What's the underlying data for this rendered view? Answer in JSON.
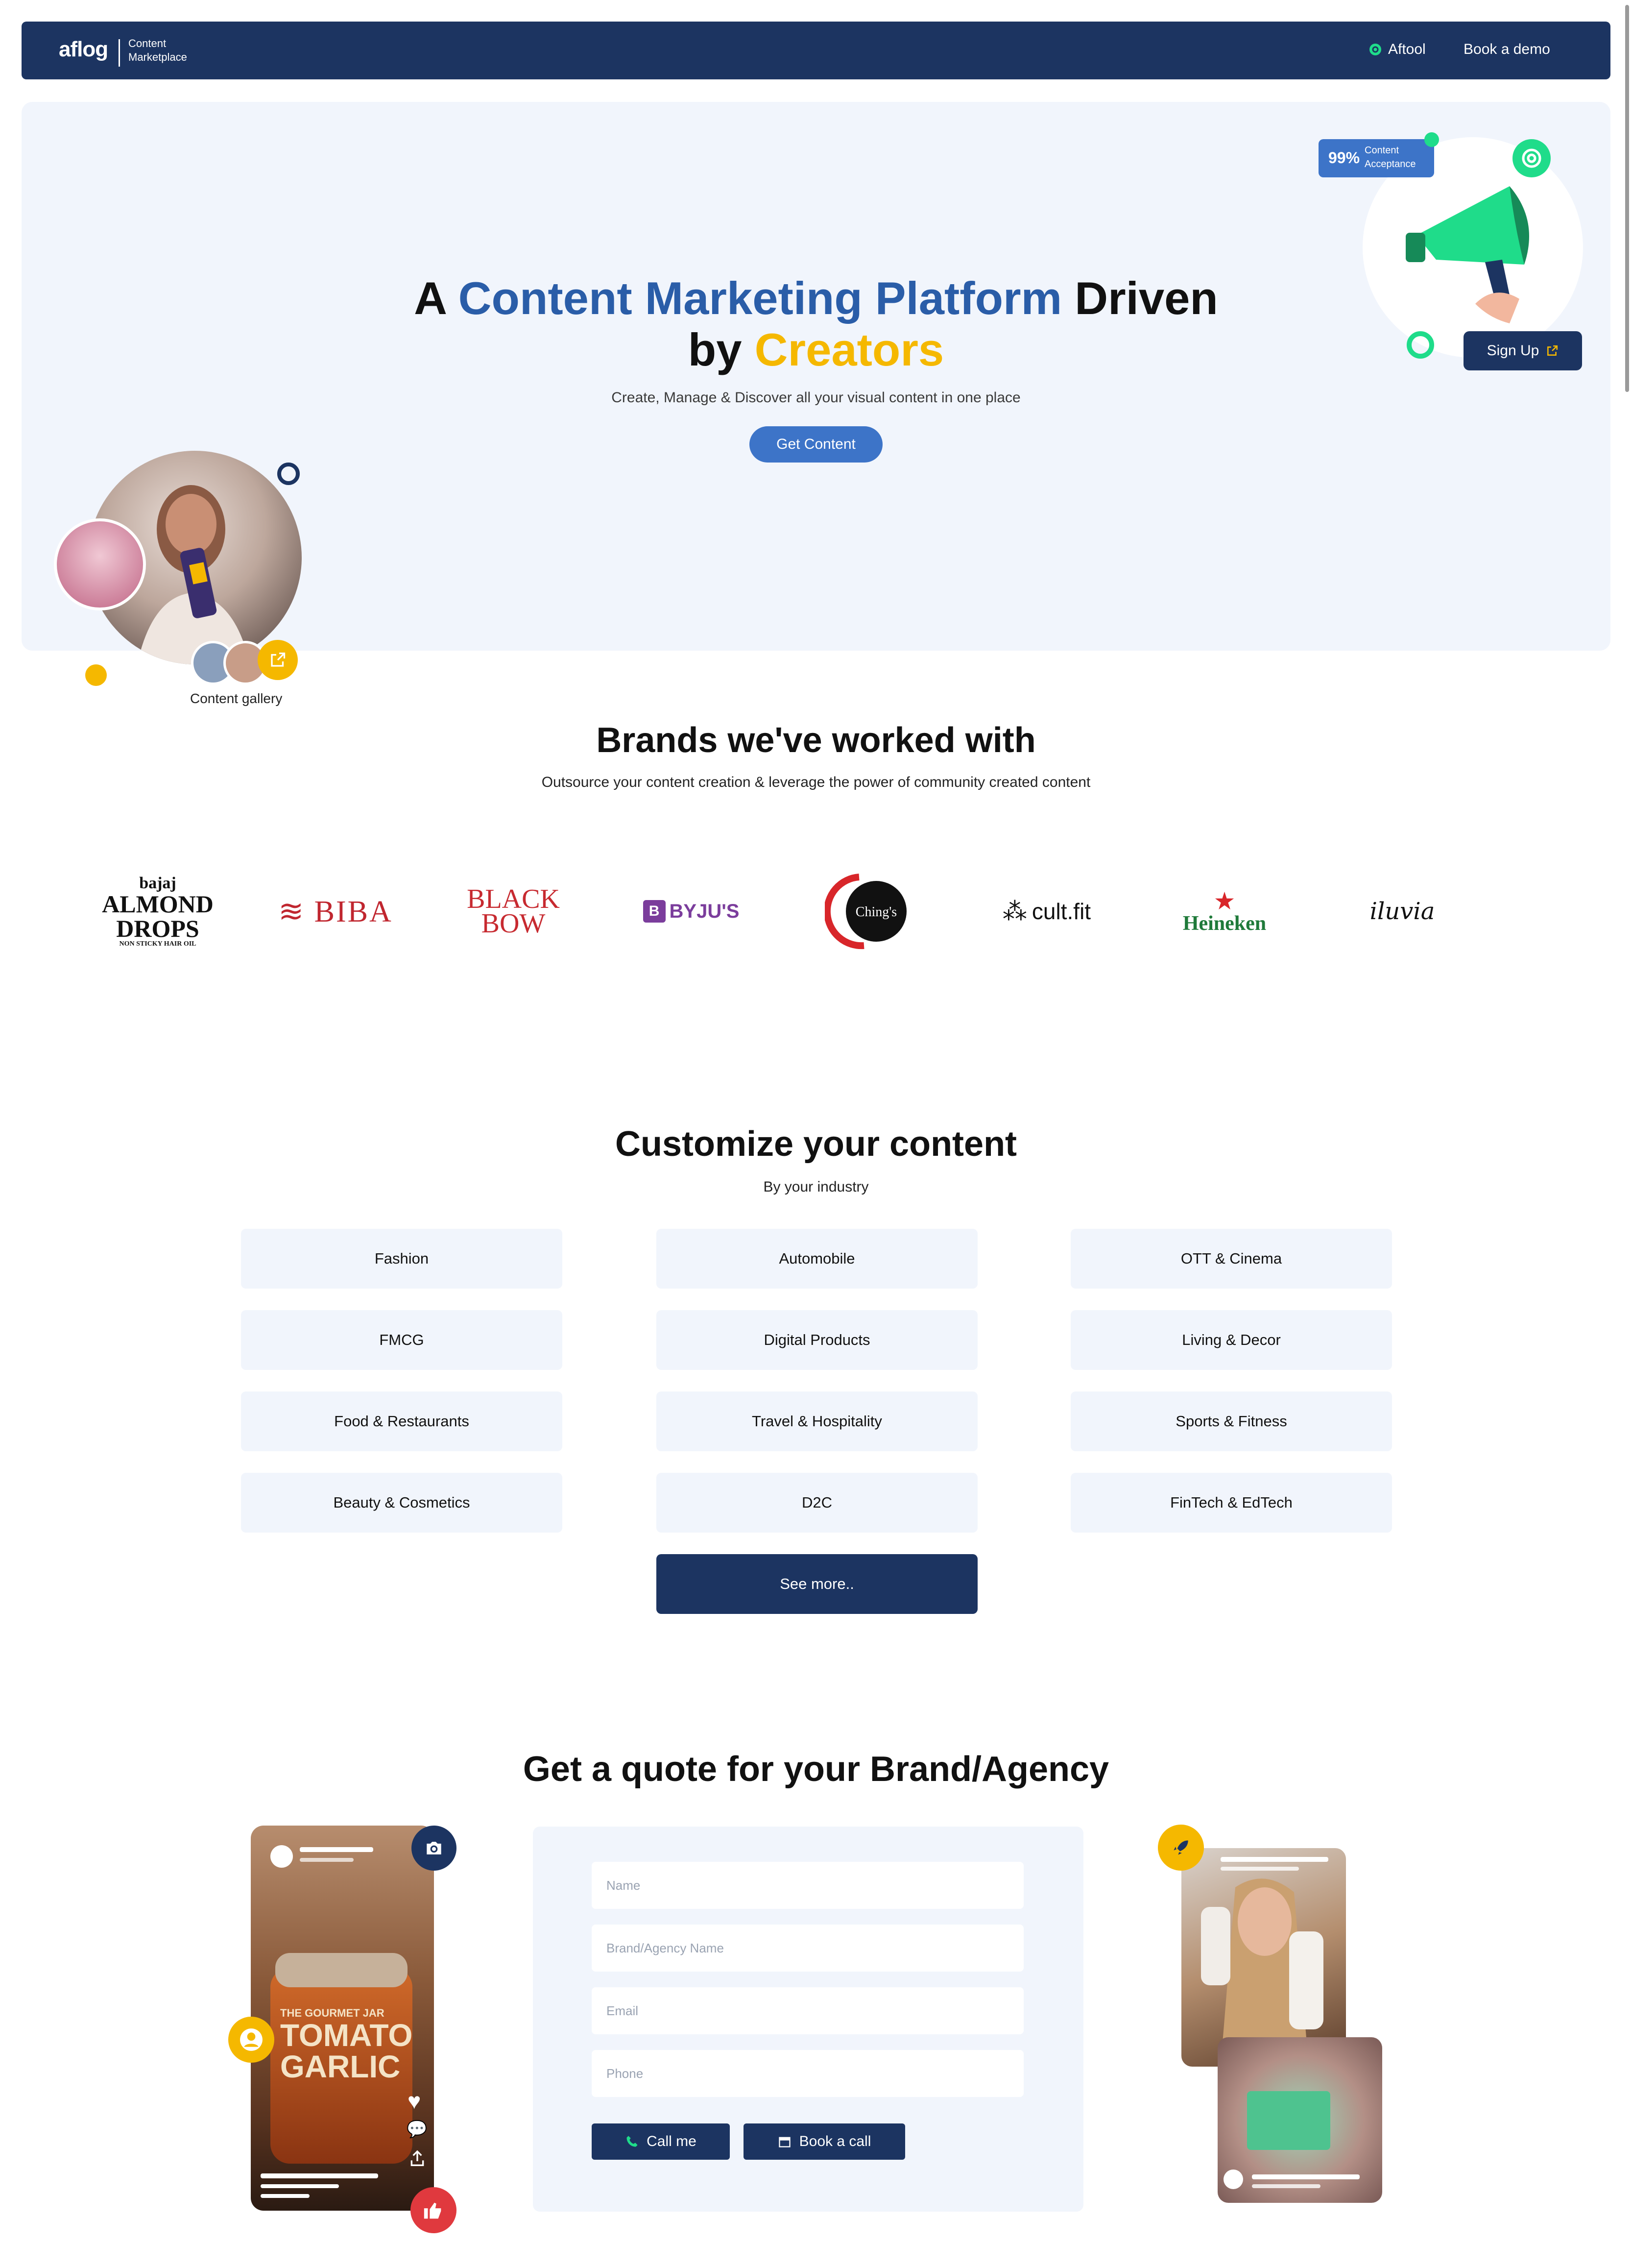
{
  "nav": {
    "logo": "aflog",
    "logo_sub_line1": "Content",
    "logo_sub_line2": "Marketplace",
    "aftool": "Aftool",
    "book_demo": "Book a demo"
  },
  "hero": {
    "title_a": "A ",
    "title_highlight": "Content Marketing Platform",
    "title_driven": " Driven",
    "title_by": "by ",
    "title_creators": "Creators",
    "subtitle": "Create, Manage & Discover all your visual content in one place",
    "cta": "Get Content",
    "gallery_label": "Content gallery",
    "badge_percent": "99%",
    "badge_line1": "Content",
    "badge_line2": "Acceptance",
    "signup": "Sign Up"
  },
  "brands": {
    "title": "Brands we've worked with",
    "subtitle": "Outsource your content creation & leverage the power of community created content",
    "logos": [
      "bajaj ALMOND DROPS",
      "BIBA",
      "BLACK BOW",
      "BYJU'S",
      "Ching's secret",
      "cult.fit",
      "Heineken",
      "iluvia"
    ]
  },
  "customize": {
    "title": "Customize your content",
    "subtitle": "By your industry",
    "industries": [
      "Fashion",
      "Automobile",
      "OTT & Cinema",
      "FMCG",
      "Digital Products",
      "Living & Decor",
      "Food & Restaurants",
      "Travel & Hospitality",
      "Sports & Fitness",
      "Beauty & Cosmetics",
      "D2C",
      "FinTech & EdTech"
    ],
    "see_more": "See more.."
  },
  "quote": {
    "title": "Get a quote for your Brand/Agency",
    "name_placeholder": "Name",
    "brand_placeholder": "Brand/Agency Name",
    "email_placeholder": "Email",
    "phone_placeholder": "Phone",
    "call_me": "Call me",
    "book_call": "Book a call",
    "jar_label_line1": "THE GOURMET JAR",
    "jar_label_line2": "TOMATO",
    "jar_label_line3": "GARLIC"
  },
  "colors": {
    "navy": "#1c3461",
    "accent_blue": "#2a5da8",
    "yellow": "#f5b800",
    "green": "#1fdc8a",
    "light_bg": "#f1f5fc"
  }
}
